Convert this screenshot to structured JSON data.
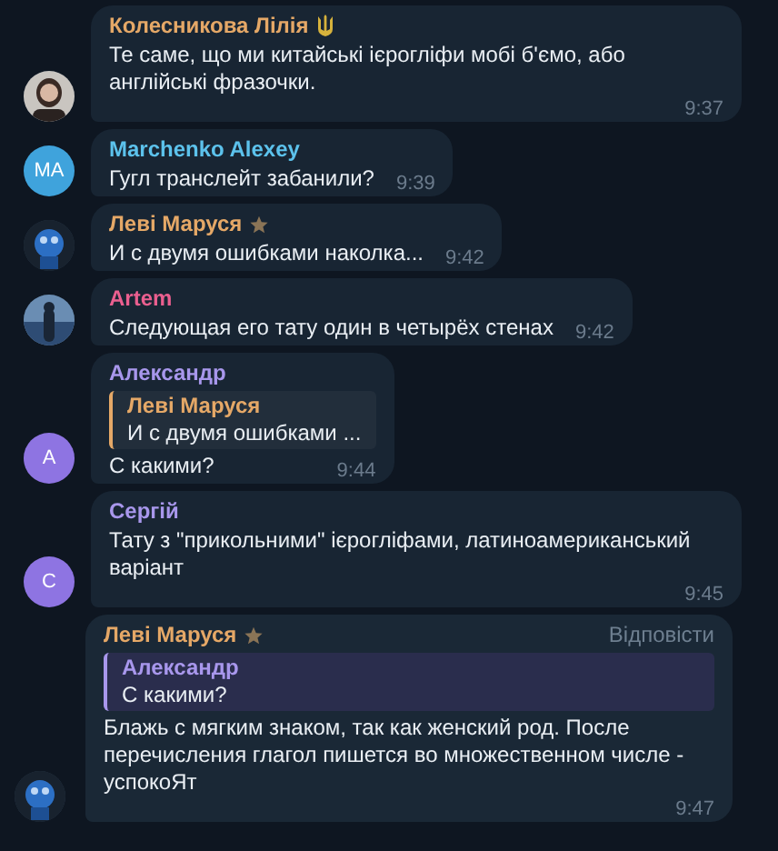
{
  "messages": [
    {
      "author": "Колесникова Лілія",
      "color": "#e5a867",
      "badge": {
        "kind": "flag"
      },
      "text": "Те саме, що ми китайські ієрогліфи мобі б'ємо, або англійські фразочки.",
      "time": "9:37"
    },
    {
      "author": "Marchenko Alexey",
      "color": "#5cc2ec",
      "avatar": {
        "kind": "initials",
        "initials": "MA",
        "color": "#3fa3dc"
      },
      "text": "Гугл транслейт забанили?",
      "time": "9:39"
    },
    {
      "author": "Леві Маруся",
      "color": "#e5a867",
      "badge": {
        "kind": "star"
      },
      "text": "И с двумя ошибками наколка...",
      "time": "9:42"
    },
    {
      "author": "Artem",
      "color": "#ea5f8f",
      "text": "Следующая его тату один в четырёх стенах",
      "time": "9:42"
    },
    {
      "author": "Александр",
      "color": "#a897ec",
      "avatar": {
        "kind": "initials",
        "initials": "A",
        "color": "#8e74e2"
      },
      "reply": {
        "author": "Леві Маруся",
        "text": "И с двумя ошибками ...",
        "color": "#e5a867"
      },
      "text": "С какими?",
      "time": "9:44"
    },
    {
      "author": "Сергій",
      "color": "#a897ec",
      "avatar": {
        "kind": "initials",
        "initials": "C",
        "color": "#8e74e2"
      },
      "text": "Тату з \"прикольними\" ієрогліфами, латиноамериканський варіант",
      "time": "9:45"
    },
    {
      "author": "Леві Маруся",
      "color": "#e5a867",
      "badge": {
        "kind": "star"
      },
      "reply": {
        "author": "Александр",
        "text": "С какими?",
        "color": "#a897ec"
      },
      "reply_action": "Відповісти",
      "text": "Блажь с мягким знаком, так как женский род. После перечисления глагол пишется во множественном числе - успокоЯт",
      "time": "9:47"
    }
  ]
}
